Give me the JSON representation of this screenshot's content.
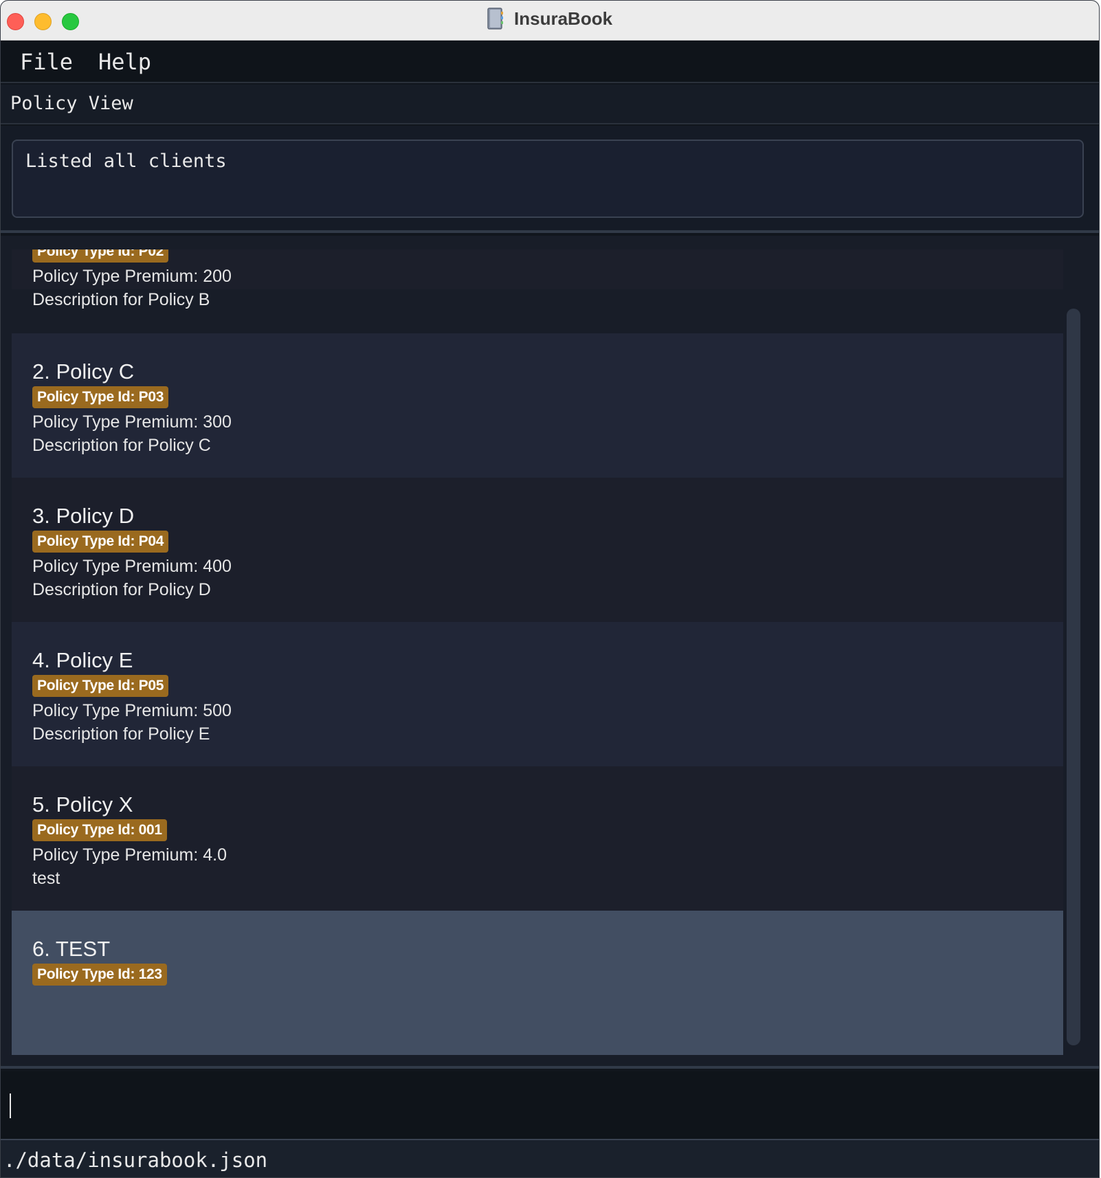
{
  "window": {
    "title": "InsuraBook"
  },
  "menu": {
    "file": "File",
    "help": "Help"
  },
  "view": {
    "label": "Policy View"
  },
  "result": {
    "message": "Listed all clients"
  },
  "policies": [
    {
      "title": "",
      "badge": "Policy Type Id: P02",
      "premium": "Policy Type Premium: 200",
      "description": "Description for Policy B"
    },
    {
      "title": "2. Policy C",
      "badge": "Policy Type Id: P03",
      "premium": "Policy Type Premium: 300",
      "description": "Description for Policy C"
    },
    {
      "title": "3. Policy D",
      "badge": "Policy Type Id: P04",
      "premium": "Policy Type Premium: 400",
      "description": "Description for Policy D"
    },
    {
      "title": "4. Policy E",
      "badge": "Policy Type Id: P05",
      "premium": "Policy Type Premium: 500",
      "description": "Description for Policy E"
    },
    {
      "title": "5. Policy X",
      "badge": "Policy Type Id: 001",
      "premium": "Policy Type Premium: 4.0",
      "description": "test"
    },
    {
      "title": "6. TEST",
      "badge": "Policy Type Id: 123",
      "premium": "",
      "description": ""
    }
  ],
  "command": {
    "value": ""
  },
  "status": {
    "file_path": "./data/insurabook.json"
  },
  "colors": {
    "badge": "#9a6a1f",
    "selected_row": "#424e62",
    "background": "#11161d"
  }
}
